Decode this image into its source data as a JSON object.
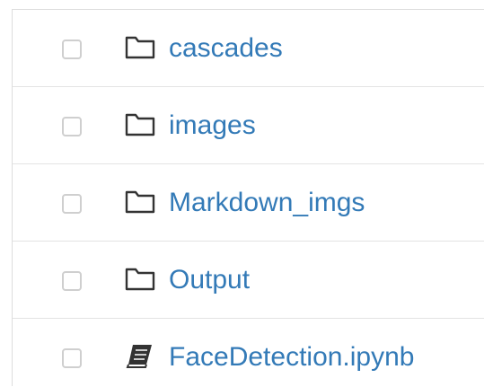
{
  "file_list": {
    "items": [
      {
        "name": "cascades",
        "type": "folder",
        "icon": "folder-icon",
        "checked": false
      },
      {
        "name": "images",
        "type": "folder",
        "icon": "folder-icon",
        "checked": false
      },
      {
        "name": "Markdown_imgs",
        "type": "folder",
        "icon": "folder-icon",
        "checked": false
      },
      {
        "name": "Output",
        "type": "folder",
        "icon": "folder-icon",
        "checked": false
      },
      {
        "name": "FaceDetection.ipynb",
        "type": "notebook",
        "icon": "notebook-icon",
        "checked": false
      }
    ]
  },
  "colors": {
    "link": "#337ab7",
    "icon": "#333333",
    "divider": "#e3e3e3",
    "checkbox_border": "#cfcfcf"
  }
}
